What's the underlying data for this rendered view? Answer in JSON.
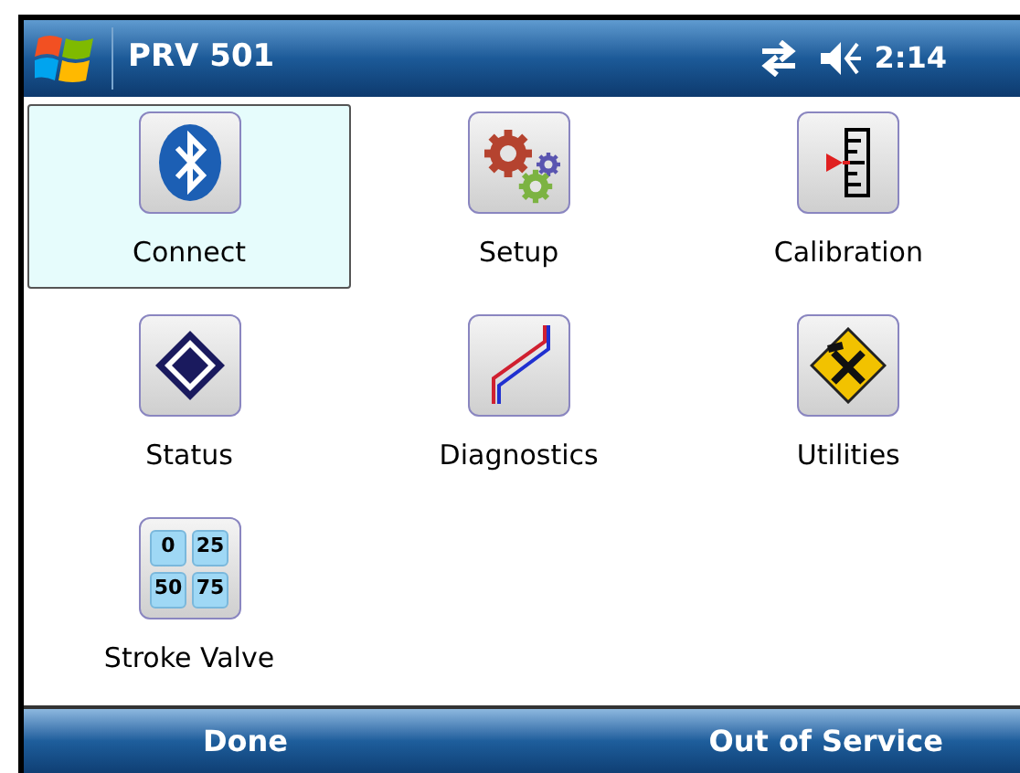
{
  "window": {
    "title": "PRV 501",
    "time": "2:14"
  },
  "items": [
    {
      "kind": "bluetooth",
      "label": "Connect",
      "selected": true
    },
    {
      "kind": "gears",
      "label": "Setup",
      "selected": false
    },
    {
      "kind": "scale",
      "label": "Calibration",
      "selected": false
    },
    {
      "kind": "diamond",
      "label": "Status",
      "selected": false
    },
    {
      "kind": "diagnostics",
      "label": "Diagnostics",
      "selected": false
    },
    {
      "kind": "tools",
      "label": "Utilities",
      "selected": false
    },
    {
      "kind": "grid",
      "label": "Stroke Valve",
      "selected": false,
      "icon_texts": [
        "0",
        "25",
        "50",
        "75"
      ]
    }
  ],
  "softkeys": [
    "Done",
    "Out of Service"
  ]
}
